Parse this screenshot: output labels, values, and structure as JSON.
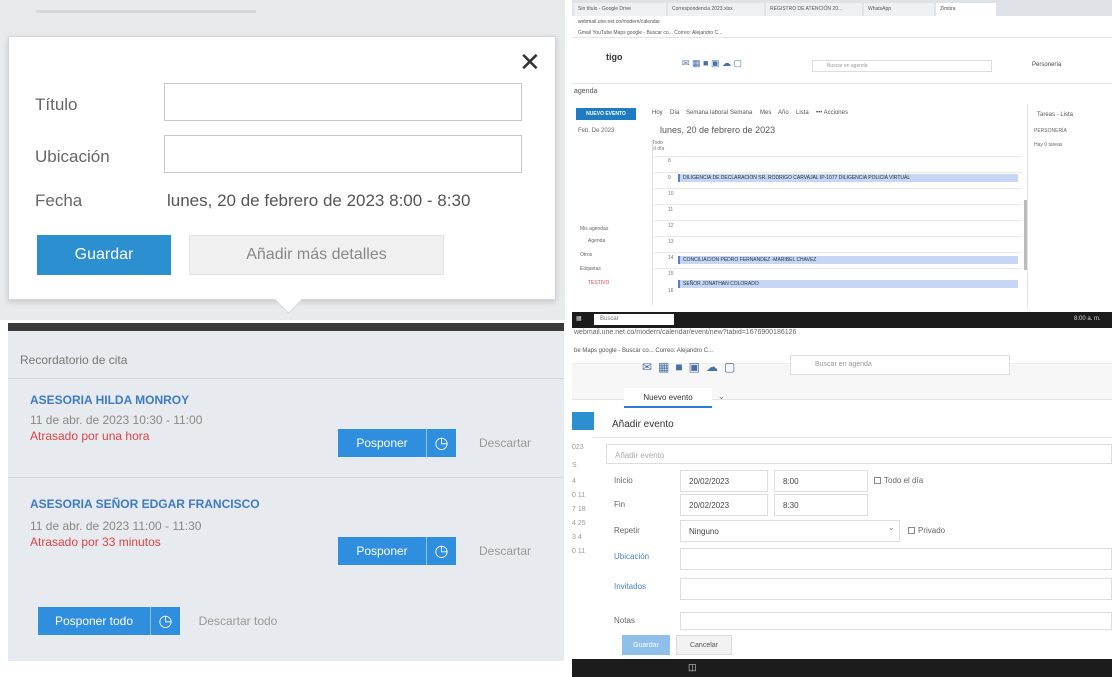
{
  "quick_add": {
    "title_label": "Título",
    "location_label": "Ubicación",
    "date_label": "Fecha",
    "date_value": "lunes, 20 de febrero de 2023 8:00 - 8:30",
    "save_label": "Guardar",
    "more_label": "Añadir más detalles",
    "close_glyph": "✕"
  },
  "reminder": {
    "header": "Recordatorio de cita",
    "items": [
      {
        "title": "ASESORIA HILDA MONROY",
        "time": "11 de abr. de 2023 10:30 - 11:00",
        "late": "Atrasado por una hora"
      },
      {
        "title": "ASESORIA SEÑOR EDGAR FRANCISCO",
        "time": "11 de abr. de 2023 11:00 - 11:30",
        "late": "Atrasado por 33 minutos"
      }
    ],
    "snooze_label": "Posponer",
    "dismiss_label": "Descartar",
    "snooze_all_label": "Posponer todo",
    "dismiss_all_label": "Descartar todo"
  },
  "calendar": {
    "tabs": [
      "Sin título - Google Drive",
      "Correspondencia 2023.xlsx",
      "REGISTRO DE ATENCIÓN 20...",
      "WhatsApp",
      "Zimbra"
    ],
    "address": "webmail.une.net.co/modern/calendar",
    "bookmarks": "Gmail   YouTube   Maps   google - Buscar co...   Correo: Alejandro C...",
    "logo": "tigo",
    "search_placeholder": "Buscar en agenda",
    "user": "Personería",
    "agenda": "agenda",
    "new_event": "NUEVO EVENTO",
    "views": [
      "Hoy",
      "Día",
      "Semana laboral",
      "Semana",
      "Mes",
      "Año",
      "Lista",
      "••• Acciones"
    ],
    "month": "Feb. De 2023",
    "date_header": "lunes, 20 de febrero de 2023",
    "all_day": "Todo el día",
    "hours": [
      "8",
      "9",
      "10",
      "11",
      "12",
      "13",
      "14",
      "15",
      "16"
    ],
    "events": [
      {
        "label": "DILIGENCIA DE DECLARACION SR. RODRIGO CARVAJAL IP-1077    DILIGENCIA POLICIA VIRTUAL"
      },
      {
        "label": "CONCILIACION PEDRO FERNANDEZ -MARIBEL CHAVEZ"
      },
      {
        "label": "SEÑOR JONATHAN COLORADO"
      }
    ],
    "tasks_title": "Tareas - Lista",
    "task_group": "PERSONERÍA",
    "task_count": "Hay 0 tareas",
    "sidebar": [
      "Mis agendas",
      "Agenda",
      "Otros",
      "Etiquetas",
      "TESTIVO"
    ]
  },
  "new_event": {
    "url": "webmail.une.net.co/modern/calendar/event/new?tabid=1676900186126",
    "bookmarks": "be   Maps   google - Buscar co...   Correo: Alejandro C...",
    "search_placeholder": "Buscar en agenda",
    "tab_label": "Nuevo evento",
    "panel_title": "Añadir evento",
    "title_placeholder": "Añadir evento",
    "start_label": "Inicio",
    "start_date": "20/02/2023",
    "start_time": "8:00",
    "all_day": "Todo el día",
    "end_label": "Fin",
    "end_date": "20/02/2023",
    "end_time": "8:30",
    "repeat_label": "Repetir",
    "repeat_value": "Ninguno",
    "private_label": "Privado",
    "location_label": "Ubicación",
    "guests_label": "Invitados",
    "notes_label": "Notas",
    "save_label": "Guardar",
    "cancel_label": "Cancelar",
    "left_nums": [
      "023",
      "S",
      "4",
      "0 11",
      "7 18",
      "4 25",
      "3 4",
      "0 11"
    ],
    "taskbar_search": "Buscar",
    "clock": "8:00 a. m."
  }
}
